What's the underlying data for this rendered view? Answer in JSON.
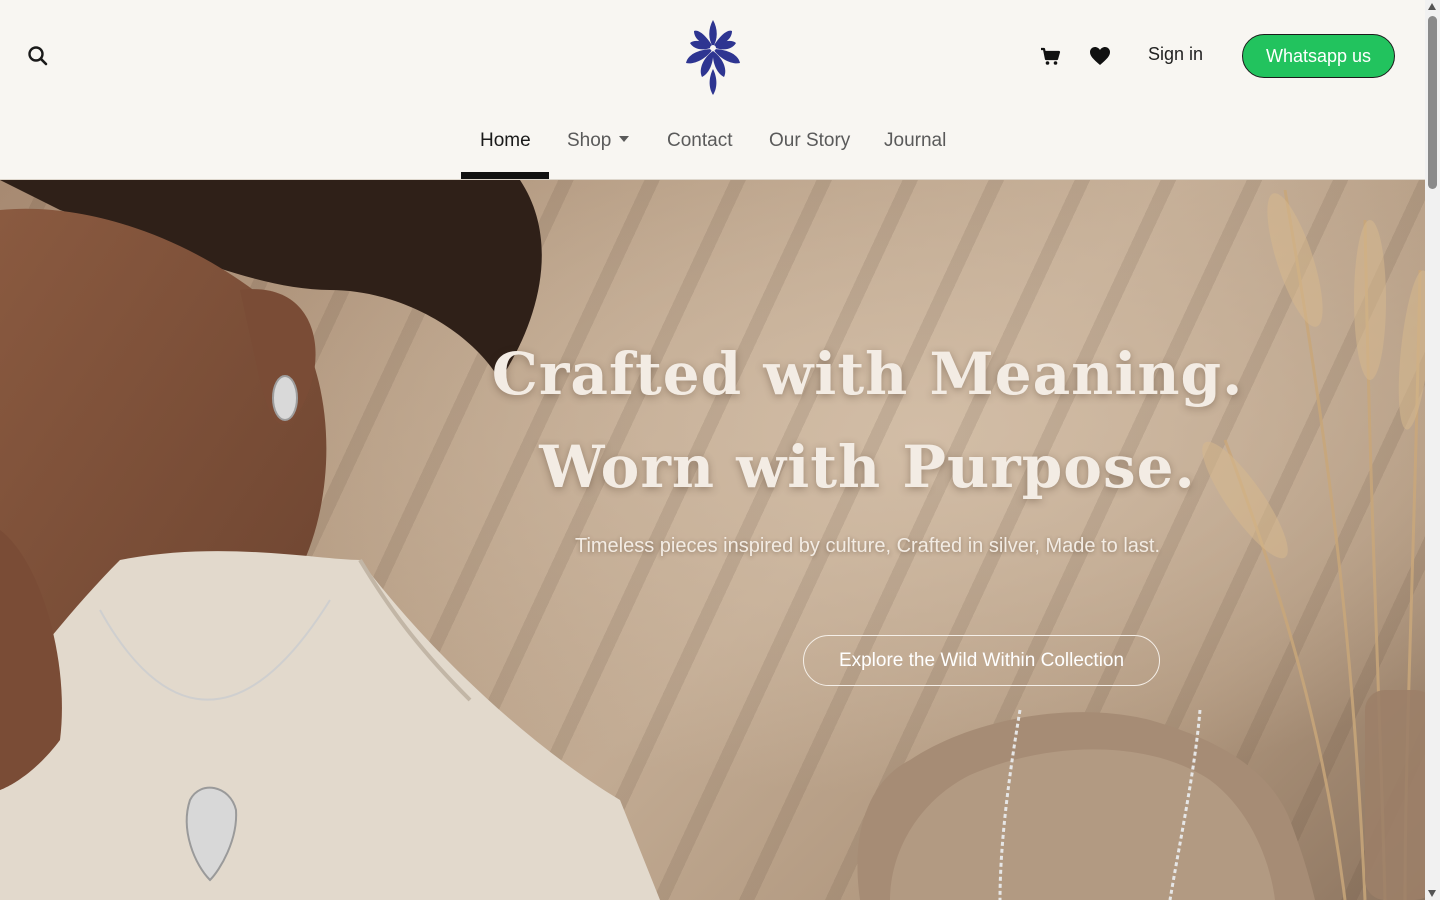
{
  "header": {
    "logo_icon": "lotus-logo",
    "signin_label": "Sign in",
    "whatsapp_label": "Whatsapp us",
    "icons": [
      "search-icon",
      "cart-icon",
      "heart-icon"
    ],
    "colors": {
      "whatsapp": "#22c35e",
      "logo": "#2e3591",
      "background": "#f8f6f2"
    }
  },
  "nav": {
    "items": [
      {
        "label": "Home",
        "active": true
      },
      {
        "label": "Shop",
        "has_dropdown": true
      },
      {
        "label": "Contact"
      },
      {
        "label": "Our Story"
      },
      {
        "label": "Journal"
      }
    ]
  },
  "hero": {
    "headline_line1": "Crafted with Meaning.",
    "headline_line2": "Worn with Purpose.",
    "subtitle": "Timeless pieces inspired by culture, Crafted in silver, Made to last.",
    "cta_label": "Explore the Wild Within Collection"
  }
}
